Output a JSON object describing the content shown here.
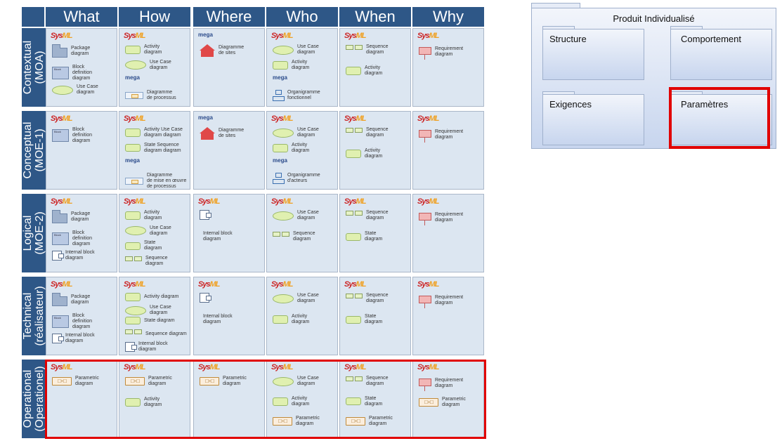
{
  "columns": [
    "What",
    "How",
    "Where",
    "Who",
    "When",
    "Why"
  ],
  "rows": [
    {
      "label": "Contextual\n(MOA)"
    },
    {
      "label": "Conceptual\n(MOE-1)"
    },
    {
      "label": "Logical\n(MOE-2)"
    },
    {
      "label": "Technical\n(réalisateur)"
    },
    {
      "label": "Operational\n(Operationel)"
    }
  ],
  "logos": {
    "sysml": "SysML",
    "mega": "mega"
  },
  "cells": [
    [
      {
        "logo": "sysml",
        "items": [
          {
            "icon": "package",
            "label": "Package\ndiagram"
          },
          {
            "icon": "block",
            "label": "Block\ndefinition\ndiagram"
          },
          {
            "icon": "usecase",
            "label": "Use Case\ndiagram"
          }
        ]
      },
      {
        "logo": "sysml",
        "items": [
          {
            "icon": "activity",
            "label": "Activity\ndiagram"
          },
          {
            "icon": "usecase",
            "label": "Use Case\ndiagram"
          },
          {
            "logo": "mega"
          },
          {
            "icon": "process",
            "label": "Diagramme\nde processus"
          }
        ]
      },
      {
        "logo": "mega",
        "items": [
          {
            "icon": "site",
            "label": "Diagramme\nde sites"
          }
        ]
      },
      {
        "logo": "sysml",
        "items": [
          {
            "icon": "usecase",
            "label": "Use Case\ndiagram"
          },
          {
            "icon": "activity",
            "label": "Activity\ndiagram"
          },
          {
            "logo": "mega"
          },
          {
            "icon": "orgchart",
            "label": "Organigramme\nfonctionnel"
          }
        ]
      },
      {
        "logo": "sysml",
        "items": [
          {
            "icon": "sequence",
            "label": "Sequence\ndiagram"
          },
          {
            "icon": "activity",
            "label": "Activity\ndiagram"
          }
        ]
      },
      {
        "logo": "sysml",
        "items": [
          {
            "icon": "requirement",
            "label": "Requirement\ndiagram"
          }
        ]
      }
    ],
    [
      {
        "logo": "sysml",
        "items": [
          {
            "icon": "block",
            "label": "Block\ndefinition\ndiagram"
          }
        ]
      },
      {
        "logo": "sysml",
        "items": [
          {
            "icon": "activity",
            "label": "Activity   Use Case\ndiagram    diagram"
          },
          {
            "icon": "state",
            "label": "State      Sequence\ndiagram    diagram"
          },
          {
            "logo": "mega"
          },
          {
            "icon": "process",
            "label": "Diagramme\nde mise en œuvre\nde processus"
          }
        ]
      },
      {
        "logo": "mega",
        "items": [
          {
            "icon": "site",
            "label": "Diagramme\nde sites"
          }
        ]
      },
      {
        "logo": "sysml",
        "items": [
          {
            "icon": "usecase",
            "label": "Use Case\ndiagram"
          },
          {
            "icon": "activity",
            "label": "Activity\ndiagram"
          },
          {
            "logo": "mega"
          },
          {
            "icon": "orgchart",
            "label": "Organigramme\nd'acteurs"
          }
        ]
      },
      {
        "logo": "sysml",
        "items": [
          {
            "icon": "sequence",
            "label": "Sequence\ndiagram"
          },
          {
            "icon": "activity",
            "label": "Activity\ndiagram"
          }
        ]
      },
      {
        "logo": "sysml",
        "items": [
          {
            "icon": "requirement",
            "label": "Requirement\ndiagram"
          }
        ]
      }
    ],
    [
      {
        "logo": "sysml",
        "items": [
          {
            "icon": "package",
            "label": "Package\ndiagram"
          },
          {
            "icon": "block",
            "label": "Block\ndefinition\ndiagram"
          },
          {
            "icon": "ibd",
            "label": "Internal block\ndiagram"
          }
        ]
      },
      {
        "logo": "sysml",
        "items": [
          {
            "icon": "activity",
            "label": "Activity\ndiagram"
          },
          {
            "icon": "usecase",
            "label": "Use Case\ndiagram"
          },
          {
            "icon": "state",
            "label": "State\ndiagram"
          },
          {
            "icon": "sequence",
            "label": "Sequence\ndiagram"
          }
        ]
      },
      {
        "logo": "sysml",
        "items": [
          {
            "icon": "ibd",
            "label": ""
          },
          {
            "icon": "none",
            "label": "Internal block\ndiagram"
          }
        ]
      },
      {
        "logo": "sysml",
        "items": [
          {
            "icon": "usecase",
            "label": "Use Case\ndiagram"
          },
          {
            "icon": "sequence",
            "label": "Sequence\ndiagram"
          }
        ]
      },
      {
        "logo": "sysml",
        "items": [
          {
            "icon": "sequence",
            "label": "Sequence\ndiagram"
          },
          {
            "icon": "state",
            "label": "State\ndiagram"
          }
        ]
      },
      {
        "logo": "sysml",
        "items": [
          {
            "icon": "requirement",
            "label": "Requirement\ndiagram"
          }
        ]
      }
    ],
    [
      {
        "logo": "sysml",
        "items": [
          {
            "icon": "package",
            "label": "Package\ndiagram"
          },
          {
            "icon": "block",
            "label": "Block\ndefinition\ndiagram"
          },
          {
            "icon": "ibd",
            "label": "Internal block\ndiagram"
          }
        ]
      },
      {
        "logo": "sysml",
        "items": [
          {
            "icon": "activity",
            "label": "Activity diagram"
          },
          {
            "icon": "usecase",
            "label": "Use Case diagram"
          },
          {
            "icon": "state",
            "label": "State diagram"
          },
          {
            "icon": "sequence",
            "label": "Sequence diagram"
          },
          {
            "icon": "ibd",
            "label": "Internal block\ndiagram"
          }
        ]
      },
      {
        "logo": "sysml",
        "items": [
          {
            "icon": "ibd",
            "label": ""
          },
          {
            "icon": "none",
            "label": "Internal block\ndiagram"
          }
        ]
      },
      {
        "logo": "sysml",
        "items": [
          {
            "icon": "usecase",
            "label": "Use Case\ndiagram"
          },
          {
            "icon": "activity",
            "label": "Activity\ndiagram"
          }
        ]
      },
      {
        "logo": "sysml",
        "items": [
          {
            "icon": "sequence",
            "label": "Sequence\ndiagram"
          },
          {
            "icon": "state",
            "label": "State\ndiagram"
          }
        ]
      },
      {
        "logo": "sysml",
        "items": [
          {
            "icon": "requirement",
            "label": "Requirement\ndiagram"
          }
        ]
      }
    ],
    [
      {
        "logo": "sysml",
        "items": [
          {
            "icon": "parametric",
            "label": "Parametric\ndiagram"
          }
        ]
      },
      {
        "logo": "sysml",
        "items": [
          {
            "icon": "parametric",
            "label": "Parametric\ndiagram"
          },
          {
            "icon": "activity",
            "label": "Activity\ndiagram"
          }
        ]
      },
      {
        "logo": "sysml",
        "items": [
          {
            "icon": "parametric",
            "label": "Parametric\ndiagram"
          }
        ]
      },
      {
        "logo": "sysml",
        "items": [
          {
            "icon": "usecase",
            "label": "Use Case\ndiagram"
          },
          {
            "icon": "activity",
            "label": "Activity\ndiagram"
          },
          {
            "icon": "parametric",
            "label": "Parametric\ndiagram"
          }
        ]
      },
      {
        "logo": "sysml",
        "items": [
          {
            "icon": "sequence",
            "label": "Sequence\ndiagram"
          },
          {
            "icon": "state",
            "label": "State\ndiagram"
          },
          {
            "icon": "parametric",
            "label": "Parametric\ndiagram"
          }
        ]
      },
      {
        "logo": "sysml",
        "items": [
          {
            "icon": "requirement",
            "label": "Requirement\ndiagram"
          },
          {
            "icon": "parametric",
            "label": "Parametric\ndiagram"
          }
        ]
      }
    ]
  ],
  "panel": {
    "title": "Produit Individualisé",
    "packages": [
      "Structure",
      "Comportement",
      "Exigences",
      "Paramètres"
    ]
  },
  "highlights": {
    "color": "#e10000"
  },
  "colors": {
    "header": "#2e5787",
    "cell": "#dce6f1"
  }
}
